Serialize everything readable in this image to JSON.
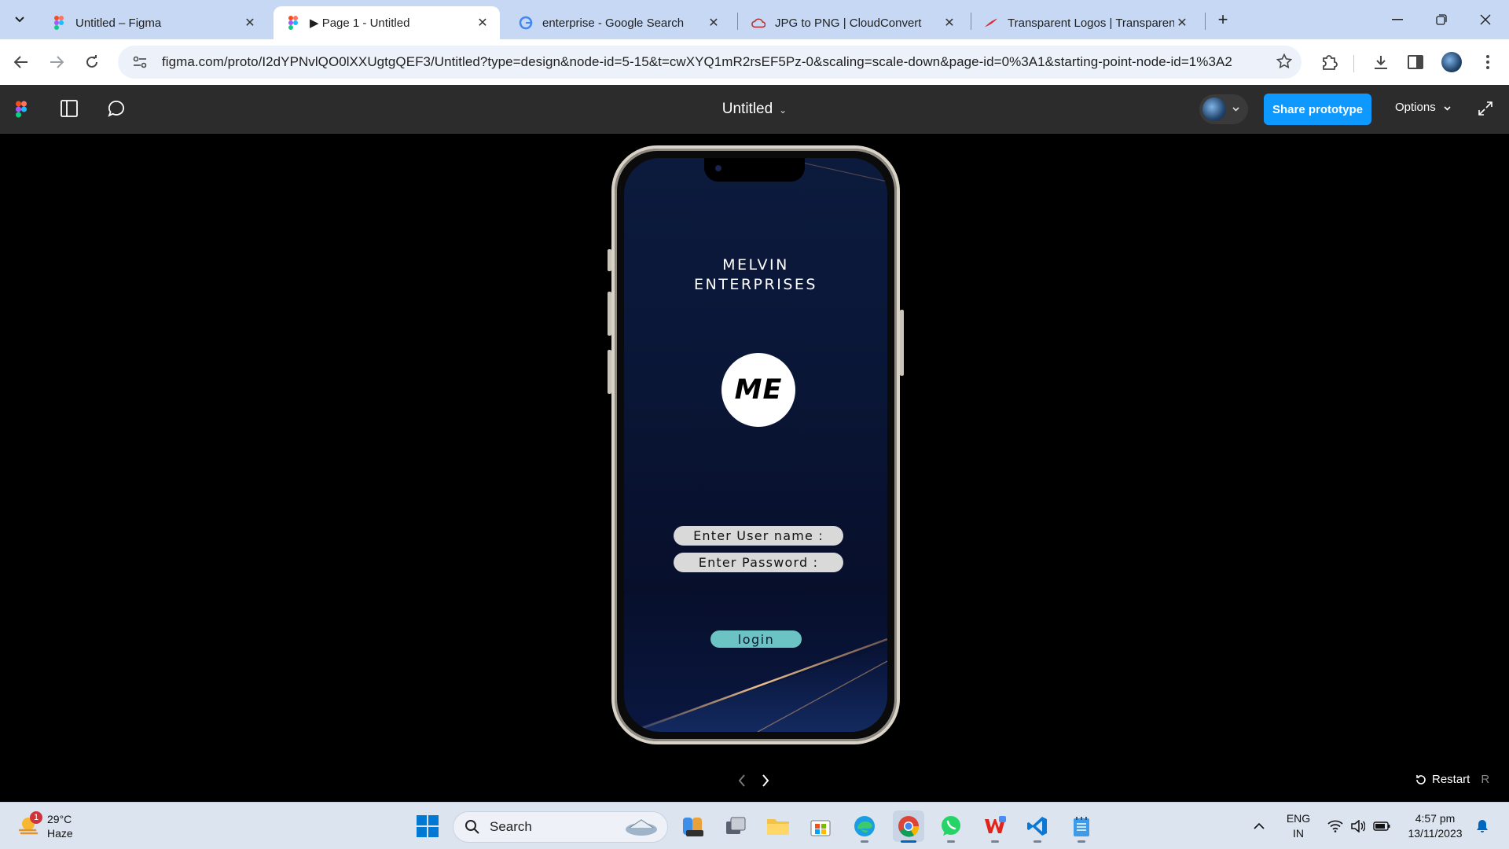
{
  "browser": {
    "tabs": [
      {
        "title": "Untitled – Figma",
        "favicon": "figma-icon"
      },
      {
        "title": "▶ Page 1 - Untitled",
        "favicon": "figma-icon",
        "active": true
      },
      {
        "title": "enterprise - Google Search",
        "favicon": "google-icon"
      },
      {
        "title": "JPG to PNG | CloudConvert",
        "favicon": "cloudconvert-icon"
      },
      {
        "title": "Transparent Logos | Transparent",
        "favicon": "transparent-logos-icon"
      }
    ],
    "url": "figma.com/proto/I2dYPNvlQO0lXXUgtgQEF3/Untitled?type=design&node-id=5-15&t=cwXYQ1mR2rsEF5Pz-0&scaling=scale-down&page-id=0%3A1&starting-point-node-id=1%3A2"
  },
  "figma": {
    "file_title": "Untitled",
    "share_label": "Share prototype",
    "options_label": "Options",
    "restart_label": "Restart",
    "restart_key": "R"
  },
  "prototype": {
    "company_line1": "MELVIN",
    "company_line2": "ENTERPRISES",
    "logo_text": "ME",
    "username_field": "Enter User name :",
    "password_field": "Enter Password :",
    "login_label": "login",
    "colors": {
      "screen_bg": "#0a1636",
      "field_bg": "#d9d9d9",
      "login_bg": "#6cc3c4",
      "accent_line": "#c8956a"
    }
  },
  "taskbar": {
    "weather_temp": "29°C",
    "weather_desc": "Haze",
    "weather_badge": "1",
    "search_label": "Search",
    "lang_line1": "ENG",
    "lang_line2": "IN",
    "time": "4:57 pm",
    "date": "13/11/2023"
  }
}
